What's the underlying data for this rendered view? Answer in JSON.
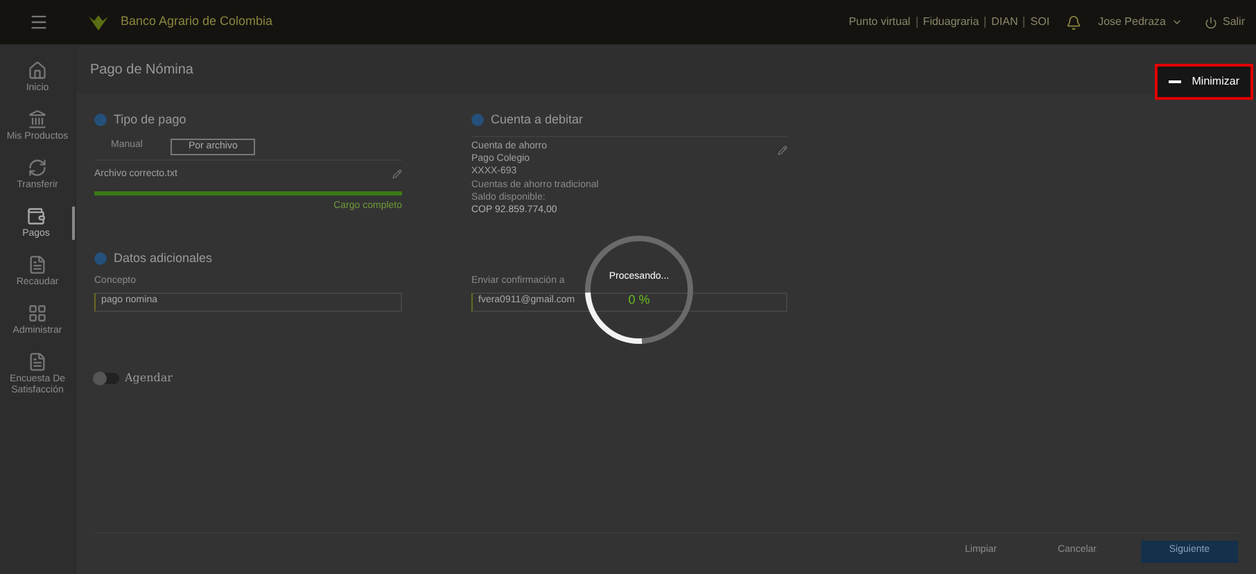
{
  "header": {
    "bank_name": "Banco Agrario de Colombia",
    "links": [
      "Punto virtual",
      "Fiduagraria",
      "DIAN",
      "SOI"
    ],
    "user": "Jose Pedraza",
    "logout": "Salir"
  },
  "sidebar": {
    "items": [
      {
        "label": "Inicio",
        "selected": false
      },
      {
        "label": "Mis Productos",
        "selected": false
      },
      {
        "label": "Transferir",
        "selected": false
      },
      {
        "label": "Pagos",
        "selected": true
      },
      {
        "label": "Recaudar",
        "selected": false
      },
      {
        "label": "Administrar",
        "selected": false
      },
      {
        "label": "Encuesta De Satisfacción",
        "selected": false
      }
    ]
  },
  "page_title": "Pago de Nómina",
  "payment_type": {
    "title": "Tipo de pago",
    "options": [
      {
        "label": "Manual",
        "selected": false
      },
      {
        "label": "Por archivo",
        "selected": true
      }
    ],
    "file_name": "Archivo correcto.txt",
    "upload": {
      "level": 1
    },
    "upload_status": "Cargo completo"
  },
  "debit_account": {
    "title": "Cuenta a debitar",
    "lines": [
      "Cuenta de ahorro",
      "Pago Colegio",
      "XXXX-693"
    ],
    "account_type": "Cuentas de ahorro tradicional",
    "balance_label": "Saldo disponible:",
    "balance": "COP 92.859.774,00"
  },
  "additional": {
    "title": "Datos adicionales",
    "fields": [
      {
        "label": "Concepto",
        "value": "pago nomina"
      },
      {
        "label": "Enviar confirmación a",
        "value": "fvera0911@gmail.com"
      }
    ]
  },
  "schedule": {
    "label": "Agendar",
    "on": false
  },
  "buttons": [
    {
      "label": "Limpiar",
      "kind": "text"
    },
    {
      "label": "Cancelar",
      "kind": "text"
    },
    {
      "label": "Siguiente",
      "kind": "primary"
    }
  ],
  "processing": {
    "title": "Procesando...",
    "percent": "0 %"
  },
  "minimize": {
    "label": "Minimizar"
  }
}
